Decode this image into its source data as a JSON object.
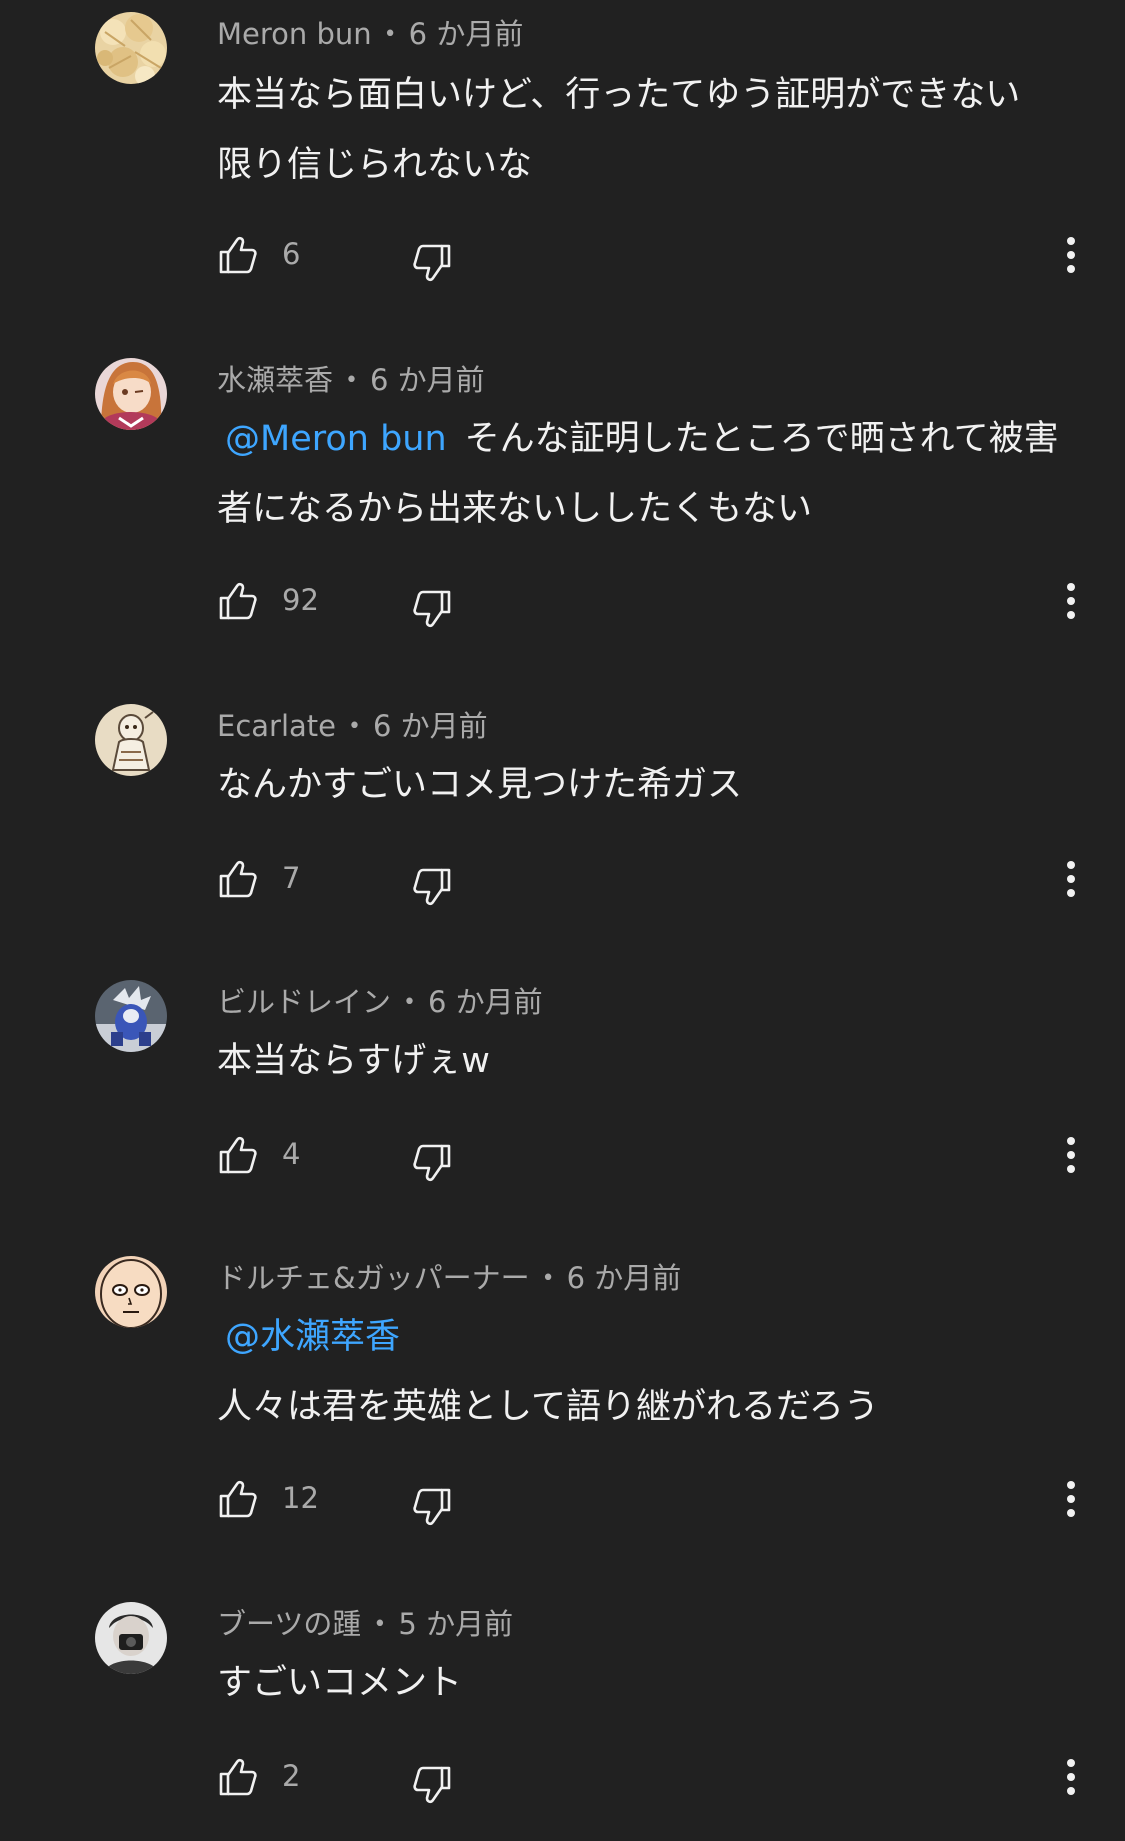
{
  "comments": [
    {
      "author": "Meron bun",
      "time": "6 か月前",
      "mention": "",
      "lines": [
        "本当なら面白いけど、行ったてゆう証明ができない",
        "限り信じられないな"
      ],
      "likes": "6",
      "avatar_icon": "melon-bread-avatar"
    },
    {
      "author": "水瀬萃香",
      "time": "6 か月前",
      "mention": "@Meron bun",
      "lines": [
        "そんな証明したところで晒されて被害",
        "者になるから出来ないししたくもない"
      ],
      "likes": "92",
      "avatar_icon": "anime-girl-avatar"
    },
    {
      "author": "Ecarlate",
      "time": "6 か月前",
      "mention": "",
      "lines": [
        "なんかすごいコメ見つけた希ガス"
      ],
      "likes": "7",
      "avatar_icon": "sketch-character-avatar"
    },
    {
      "author": "ビルドレイン",
      "time": "6 か月前",
      "mention": "",
      "lines": [
        "本当ならすげぇw"
      ],
      "likes": "4",
      "avatar_icon": "robot-figure-avatar"
    },
    {
      "author": "ドルチェ&ガッパーナー",
      "time": "6 か月前",
      "mention": "@水瀬萃香",
      "lines": [
        "人々は君を英雄として語り継がれるだろう"
      ],
      "likes": "12",
      "avatar_icon": "bald-face-avatar"
    },
    {
      "author": "ブーツの踵",
      "time": "5 か月前",
      "mention": "",
      "lines": [
        "すごいコメント"
      ],
      "likes": "2",
      "avatar_icon": "photo-person-avatar"
    }
  ],
  "icons": {
    "like": "thumbs-up-icon",
    "dislike": "thumbs-down-icon",
    "more": "more-vertical-icon"
  },
  "colors": {
    "background": "#212121",
    "text": "#f1f1f1",
    "secondary": "#aaaaaa",
    "mention": "#3ea6ff"
  }
}
